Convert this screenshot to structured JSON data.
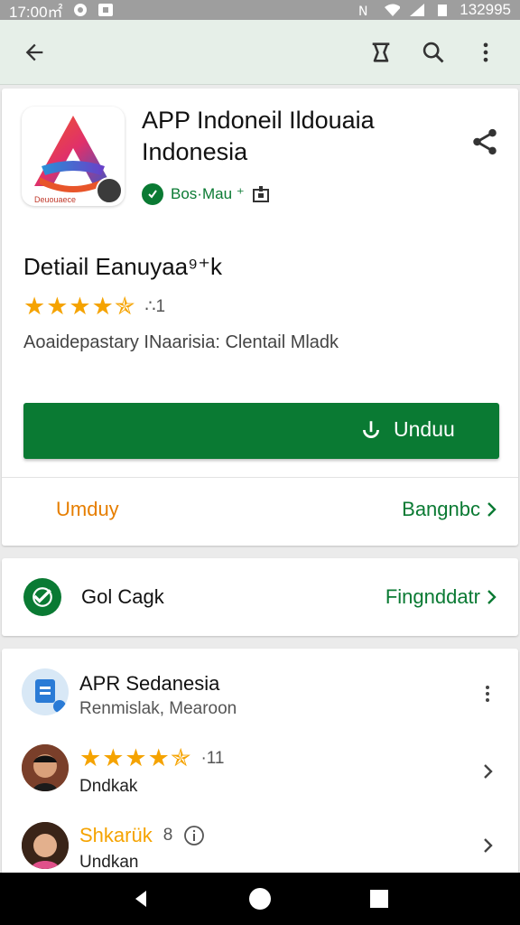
{
  "status_bar": {
    "time": "17:00㎡",
    "right_text": "132995"
  },
  "app": {
    "title_line1": "APP Indoneil Ildouaia",
    "title_line2": "Indonesia",
    "icon_label": "Deuouaece",
    "developer": "Bos·Mau ⁺"
  },
  "details": {
    "heading": "Detiail Eanuyaa⁹⁺k",
    "rating_stars": "★★★★✯",
    "rating_value": 4.5,
    "rating_count": "∴1",
    "description": "Aoaidepastary INaarisia: Clentail Mladk"
  },
  "install_button": {
    "label": "Unduu"
  },
  "links": {
    "left": "Umduy",
    "right": "Bangnbc"
  },
  "safety": {
    "label": "Gol Cagk",
    "link": "Fingnddatr"
  },
  "reviews": [
    {
      "title": "APR Sedanesia",
      "subtitle": "Renmislak, Mearoon"
    },
    {
      "stars": "★★★★✯",
      "count": "·11",
      "name": "Dndkak"
    },
    {
      "title": "Shkarük",
      "count": "8",
      "name": "Undkan"
    }
  ],
  "colors": {
    "accent_green": "#0a7a33",
    "star": "#f5a300",
    "orange": "#e67e00"
  },
  "icons": [
    "back-arrow-icon",
    "bookmark-icon",
    "search-icon",
    "more-vert-icon",
    "share-icon",
    "verified-icon",
    "badge-icon",
    "download-icon",
    "chevron-right-icon",
    "shield-check-icon",
    "info-icon"
  ]
}
